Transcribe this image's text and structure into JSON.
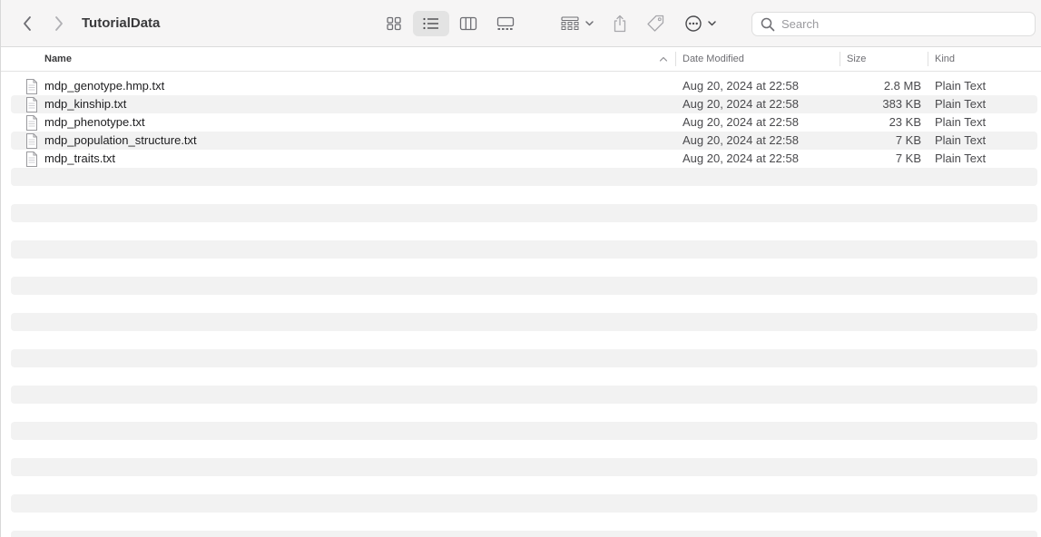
{
  "window": {
    "title": "TutorialData"
  },
  "toolbar": {
    "back": "chevron-left-icon",
    "forward": "chevron-right-icon",
    "views": [
      "icon-view-icon",
      "list-view-icon",
      "column-view-icon",
      "gallery-view-icon"
    ],
    "active_view": "list-view-icon",
    "group": "group-icon",
    "share": "share-icon",
    "tag": "tag-icon",
    "more": "ellipsis-circle-icon"
  },
  "search": {
    "placeholder": "Search",
    "value": ""
  },
  "columns": {
    "name": "Name",
    "date": "Date Modified",
    "size": "Size",
    "kind": "Kind"
  },
  "files": [
    {
      "name": "mdp_genotype.hmp.txt",
      "date": "Aug 20, 2024 at 22:58",
      "size": "2.8 MB",
      "kind": "Plain Text"
    },
    {
      "name": "mdp_kinship.txt",
      "date": "Aug 20, 2024 at 22:58",
      "size": "383 KB",
      "kind": "Plain Text"
    },
    {
      "name": "mdp_phenotype.txt",
      "date": "Aug 20, 2024 at 22:58",
      "size": "23 KB",
      "kind": "Plain Text"
    },
    {
      "name": "mdp_population_structure.txt",
      "date": "Aug 20, 2024 at 22:58",
      "size": "7 KB",
      "kind": "Plain Text"
    },
    {
      "name": "mdp_traits.txt",
      "date": "Aug 20, 2024 at 22:58",
      "size": "7 KB",
      "kind": "Plain Text"
    }
  ],
  "colors": {
    "toolbar_bg": "#f6f5f5",
    "stripe": "#f2f2f2",
    "active_view_bg": "#e3e3e3",
    "icon": "#6e6e73"
  }
}
